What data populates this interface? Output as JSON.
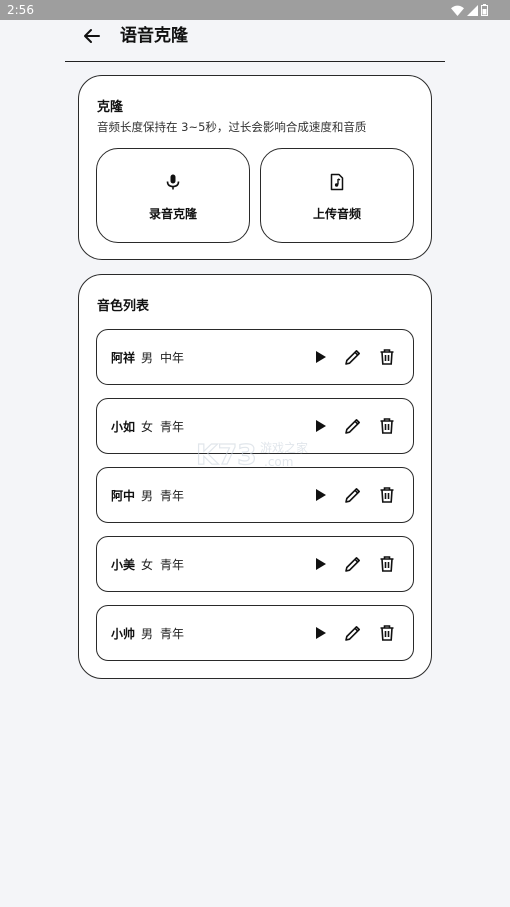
{
  "status_bar": {
    "time": "2:56"
  },
  "header": {
    "title": "语音克隆"
  },
  "clone_card": {
    "title": "克隆",
    "description": "音频长度保持在 3~5秒，过长会影响合成速度和音质",
    "record_label": "录音克隆",
    "upload_label": "上传音频"
  },
  "voice_list": {
    "title": "音色列表",
    "items": [
      {
        "name": "阿祥",
        "gender": "男",
        "age": "中年"
      },
      {
        "name": "小如",
        "gender": "女",
        "age": "青年"
      },
      {
        "name": "阿中",
        "gender": "男",
        "age": "青年"
      },
      {
        "name": "小美",
        "gender": "女",
        "age": "青年"
      },
      {
        "name": "小帅",
        "gender": "男",
        "age": "青年"
      }
    ]
  },
  "watermark": {
    "text": "K73 游戏之家 .com"
  },
  "colors": {
    "accent": "#111111",
    "background": "#f4f5f8",
    "status_bar": "#9e9e9e"
  }
}
